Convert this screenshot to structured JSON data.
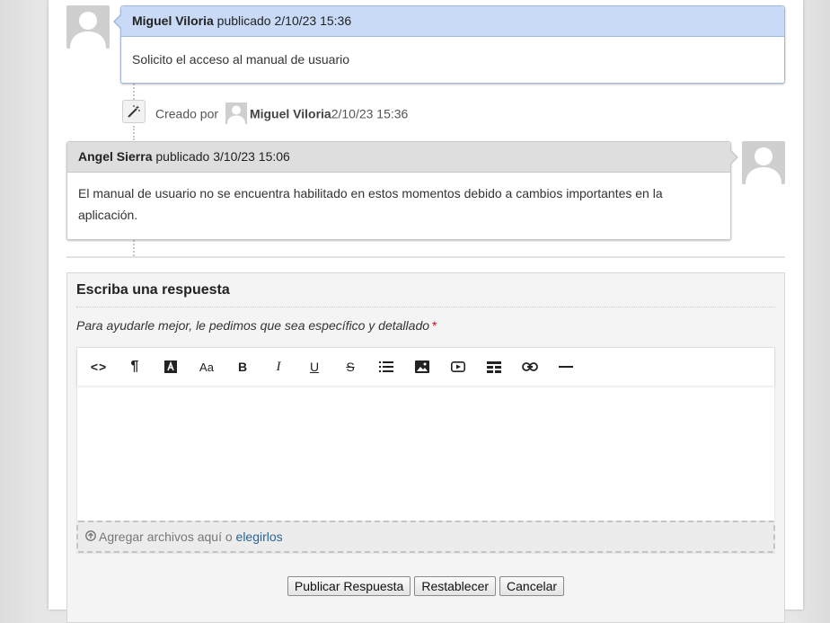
{
  "comments": [
    {
      "author": "Miguel Viloria",
      "meta": "publicado 2/10/23 15:36",
      "body": "Solicito el acceso al manual de usuario"
    },
    {
      "author": "Angel Sierra",
      "meta": "publicado 3/10/23 15:06",
      "body_line1": "El manual de usuario no se encuentra habilitado en estos momentos debido a cambios importantes en la",
      "body_line2": "aplicación."
    }
  ],
  "event": {
    "prefix": "Creado por",
    "user": "Miguel Viloria",
    "time": "2/10/23 15:36",
    "icon": "magic-wand-icon"
  },
  "reply": {
    "title": "Escriba una respuesta",
    "hint": "Para ayudarle mejor, le pedimos que sea específico y detallado",
    "required_mark": "*",
    "toolbar": {
      "code": "<>",
      "paragraph": "¶",
      "font_size": "Aa",
      "bold": "B",
      "italic": "I",
      "underline": "U",
      "strike": "S"
    },
    "dropzone_text": "Agregar archivos aquí o",
    "dropzone_link": "elegirlos",
    "buttons": {
      "publish": "Publicar Respuesta",
      "reset": "Restablecer",
      "cancel": "Cancelar"
    }
  },
  "colors": {
    "own_comment_header": "#c8daf5",
    "other_comment_header": "#dedede",
    "required": "#d0021b",
    "link": "#2a6496"
  }
}
